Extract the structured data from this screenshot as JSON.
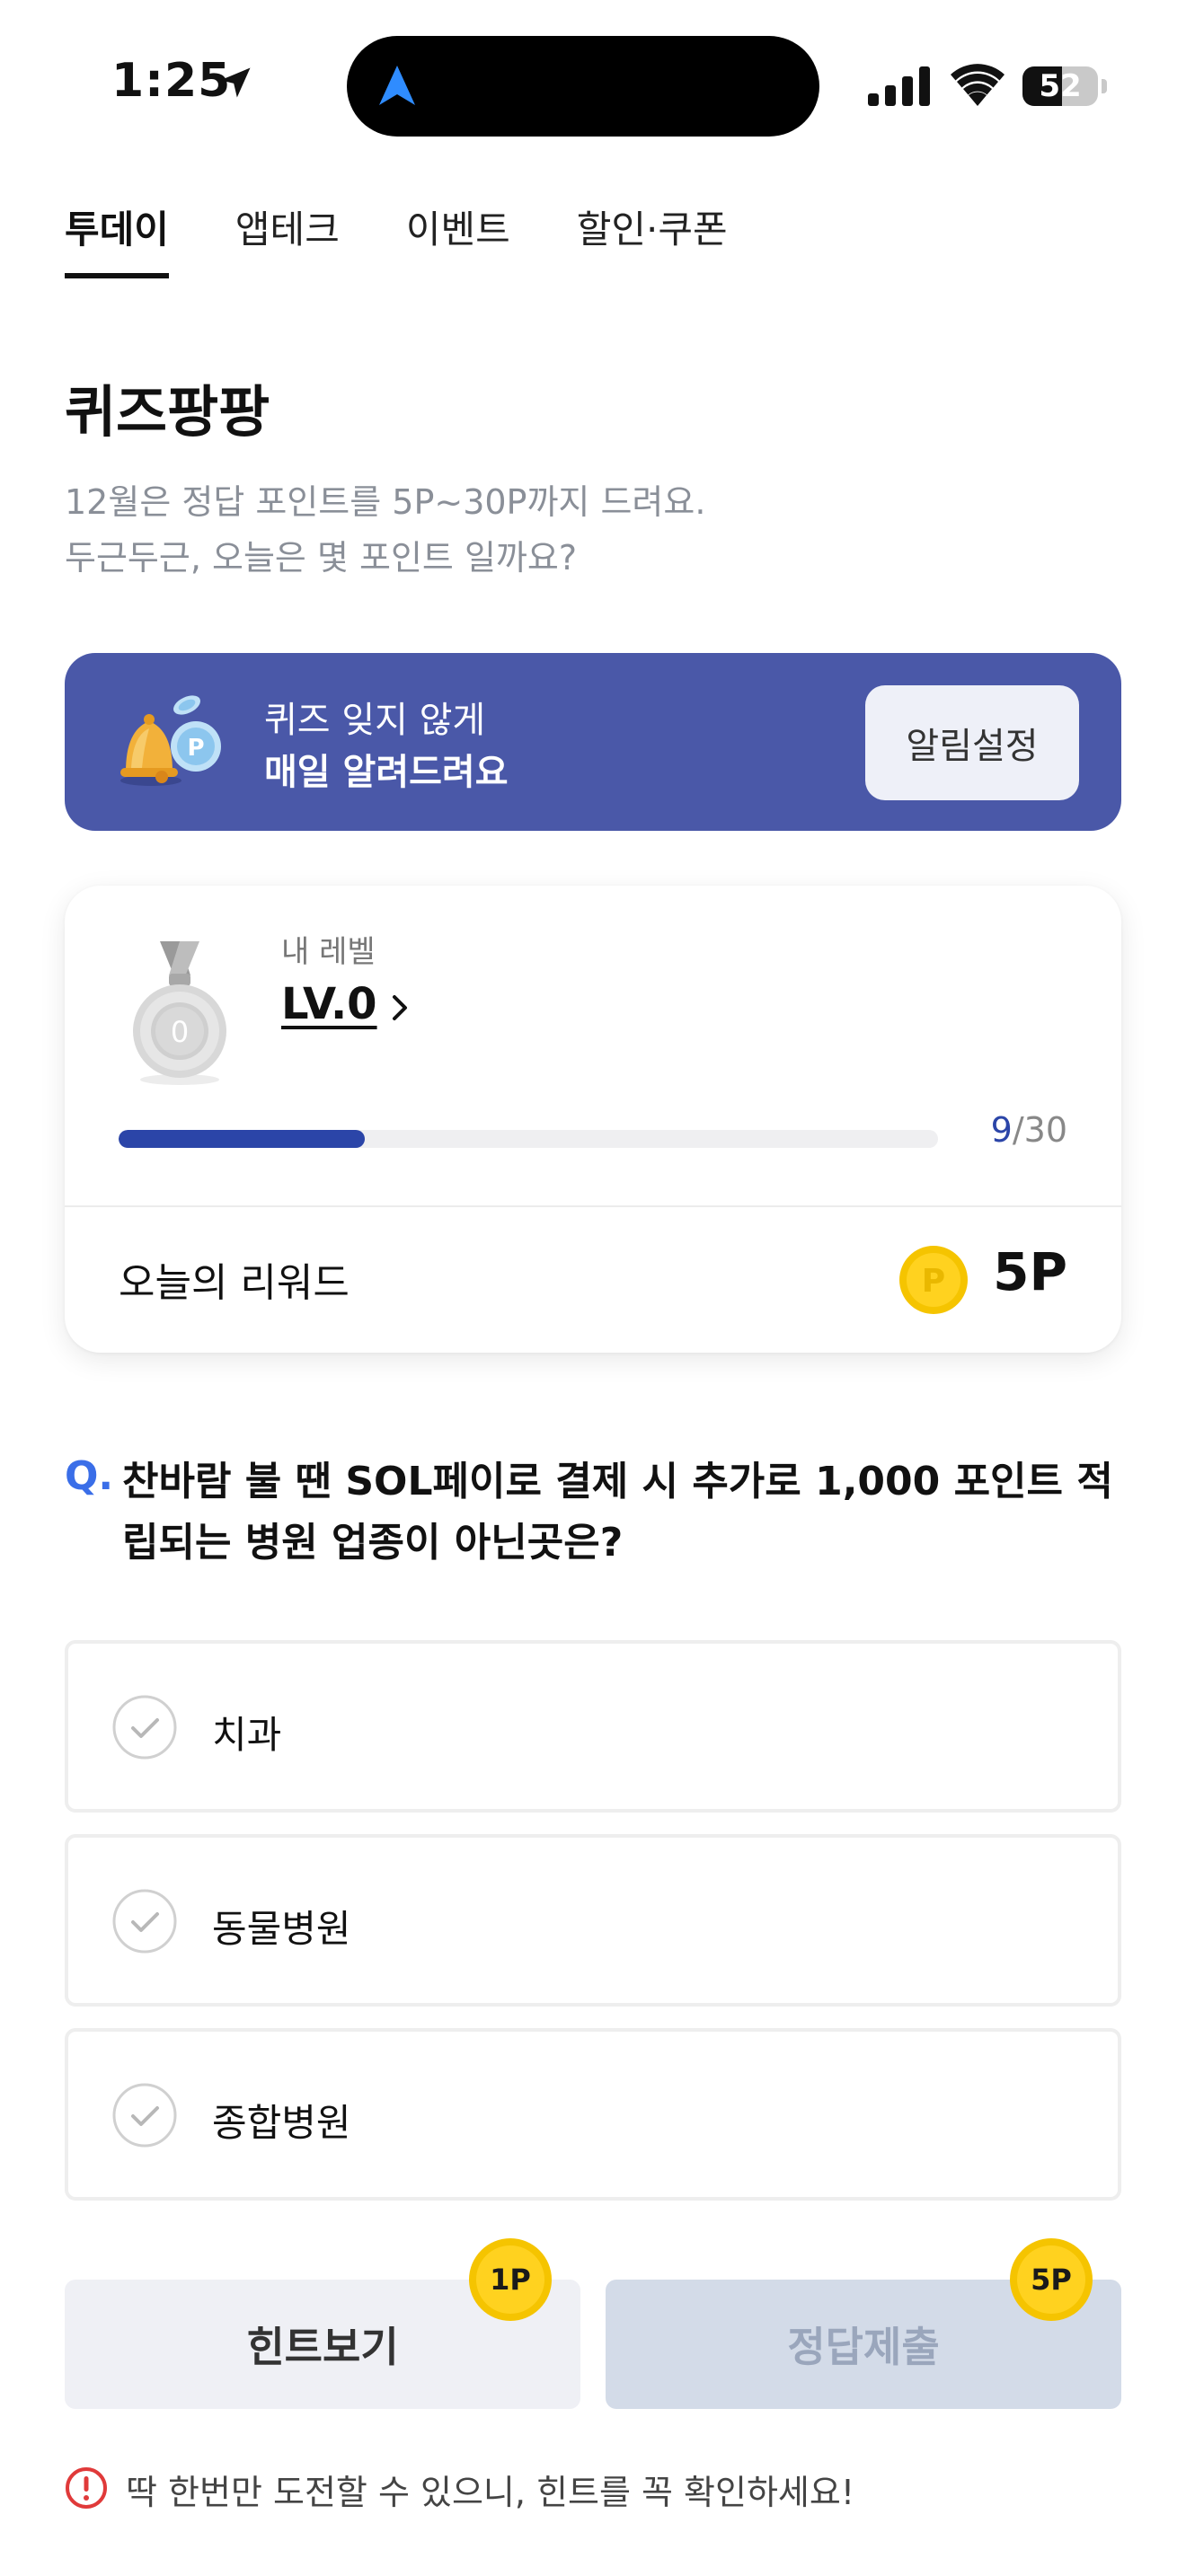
{
  "status_bar": {
    "time": "1:25",
    "battery": "52",
    "battery_level": 0.52
  },
  "tabs": [
    {
      "label": "투데이",
      "active": true
    },
    {
      "label": "앱테크",
      "active": false
    },
    {
      "label": "이벤트",
      "active": false
    },
    {
      "label": "할인·쿠폰",
      "active": false
    }
  ],
  "page": {
    "title": "퀴즈팡팡",
    "desc_line1": "12월은 정답 포인트를 5P~30P까지 드려요.",
    "desc_line2": "두근두근, 오늘은 몇 포인트 일까요?"
  },
  "banner": {
    "line1": "퀴즈 잊지 않게",
    "line2": "매일 알려드려요",
    "button": "알림설정"
  },
  "level": {
    "label": "내 레벨",
    "value": "LV.0",
    "medal_number": "0",
    "progress_current": "9",
    "progress_total": "/30",
    "progress_fraction": 0.3,
    "reward_label": "오늘의 리워드",
    "coin_symbol": "P",
    "reward_value": "5P"
  },
  "question": {
    "mark": "Q.",
    "text": "찬바람 불 땐 SOL페이로 결제 시 추가로 1,000 포인트 적립되는 병원 업종이 아닌곳은?"
  },
  "options": [
    {
      "label": "치과"
    },
    {
      "label": "동물병원"
    },
    {
      "label": "종합병원"
    }
  ],
  "actions": {
    "hint_label": "힌트보기",
    "hint_cost": "1P",
    "submit_label": "정답제출",
    "submit_reward": "5P"
  },
  "notice": "딱 한번만 도전할 수 있으니, 힌트를 꼭 확인하세요!",
  "colors": {
    "accent_blue": "#2b45a8",
    "banner_bg": "#4a58a8",
    "question_mark": "#3a6ee8",
    "warning_red": "#e03a3a",
    "coin_gold": "#f5c400"
  }
}
